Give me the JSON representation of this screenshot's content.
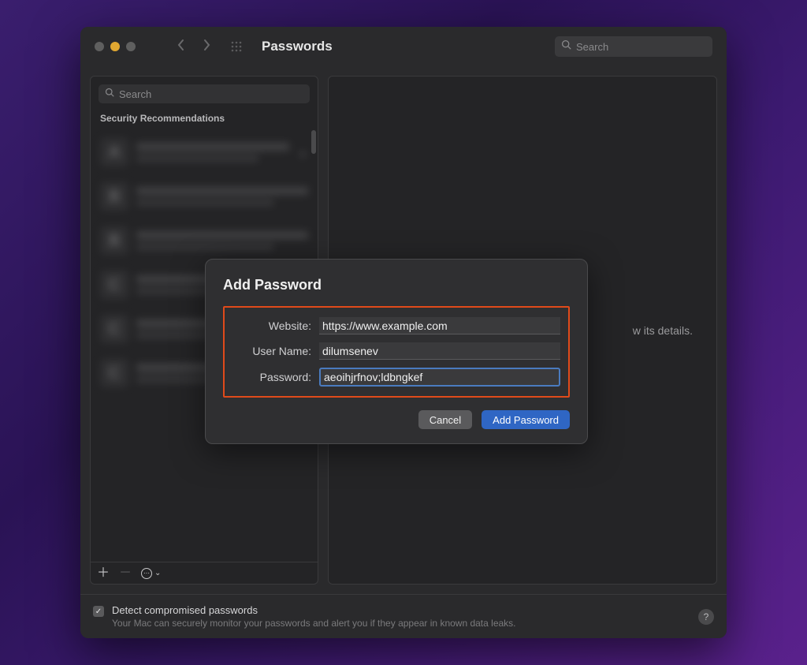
{
  "window": {
    "title": "Passwords",
    "search_placeholder": "Search"
  },
  "sidebar": {
    "search_placeholder": "Search",
    "section_header": "Security Recommendations",
    "items": [
      {
        "letter": "A"
      },
      {
        "letter": "B"
      },
      {
        "letter": "B"
      },
      {
        "letter": "C"
      },
      {
        "letter": "C"
      },
      {
        "letter": "C"
      }
    ]
  },
  "main": {
    "placeholder_text_tail": "w its details."
  },
  "bottom": {
    "checkbox_label": "Detect compromised passwords",
    "subtext": "Your Mac can securely monitor your passwords and alert you if they appear in known data leaks.",
    "help": "?"
  },
  "modal": {
    "title": "Add Password",
    "website_label": "Website:",
    "website_value": "https://www.example.com",
    "username_label": "User Name:",
    "username_value": "dilumsenev",
    "password_label": "Password:",
    "password_value": "aeoihjrfnov;ldbngkef",
    "cancel": "Cancel",
    "submit": "Add Password"
  }
}
